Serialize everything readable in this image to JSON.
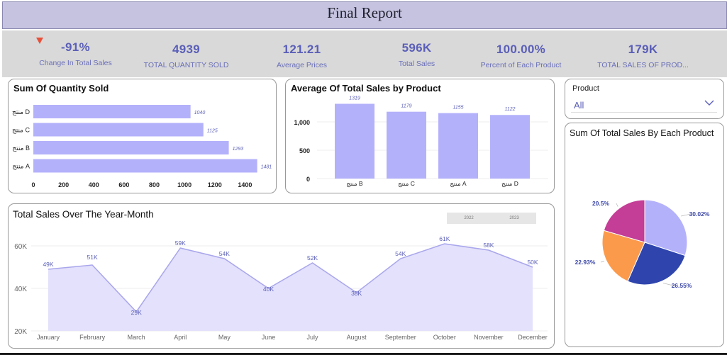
{
  "header": {
    "title": "Final Report"
  },
  "kpis": [
    {
      "value": "-91%",
      "label": "Change In Total Sales",
      "indicator": "down-arrow",
      "indicator_color": "#e8503a"
    },
    {
      "value": "4939",
      "label": "TOTAL QUANTITY SOLD"
    },
    {
      "value": "121.21",
      "label": "Average Prices"
    },
    {
      "value": "596K",
      "label": "Total Sales"
    },
    {
      "value": "100.00%",
      "label": "Percent of Each Product"
    },
    {
      "value": "179K",
      "label": "TOTAL SALES OF PROD..."
    }
  ],
  "colors": {
    "bar": "#b4b1fb",
    "area_fill": "#e3e1fb",
    "area_line": "#a9a6ec",
    "kpi_text": "#5b5fb8",
    "header_bg": "#c5c3e0"
  },
  "slicer": {
    "label": "Product",
    "value": "All"
  },
  "year_tabs": [
    "2022",
    "2023"
  ],
  "chart_data": [
    {
      "type": "bar",
      "orientation": "horizontal",
      "title": "Sum Of Quantity Sold",
      "categories": [
        "منتج D",
        "منتج C",
        "منتج B",
        "منتج A"
      ],
      "values": [
        1040,
        1125,
        1293,
        1481
      ],
      "data_labels": [
        "1040",
        "1125",
        "1293",
        "1481"
      ],
      "xlim": [
        0,
        1600
      ],
      "xticks": [
        "0",
        "200",
        "400",
        "600",
        "800",
        "1000",
        "1200",
        "1400"
      ]
    },
    {
      "type": "bar",
      "title": "Average Of Total Sales by Product",
      "categories": [
        "منتج B",
        "منتج C",
        "منتج A",
        "منتج D"
      ],
      "values": [
        1319,
        1179,
        1155,
        1122
      ],
      "data_labels": [
        "1319",
        "1179",
        "1155",
        "1122"
      ],
      "ylim": [
        0,
        1400
      ],
      "yticks": [
        "0",
        "500",
        "1,000"
      ]
    },
    {
      "type": "area",
      "title": "Total Sales Over The Year-Month",
      "categories": [
        "January",
        "February",
        "March",
        "April",
        "May",
        "June",
        "July",
        "August",
        "September",
        "October",
        "November",
        "December"
      ],
      "values": [
        49,
        51,
        29,
        59,
        54,
        40,
        52,
        38,
        54,
        61,
        58,
        50
      ],
      "data_labels": [
        "49K",
        "51K",
        "29K",
        "59K",
        "54K",
        "40K",
        "52K",
        "38K",
        "54K",
        "61K",
        "58K",
        "50K"
      ],
      "ylim": [
        20,
        65
      ],
      "yticks": [
        "20K",
        "40K",
        "60K"
      ],
      "grid": true
    },
    {
      "type": "pie",
      "title": "Sum Of Total Sales By Each Product",
      "slices": [
        {
          "value": 30.02,
          "label": "30.02%",
          "color": "#b4b1fb"
        },
        {
          "value": 26.55,
          "label": "26.55%",
          "color": "#2f45ad"
        },
        {
          "value": 22.93,
          "label": "22.93%",
          "color": "#fc9a4c"
        },
        {
          "value": 20.5,
          "label": "20.5%",
          "color": "#c43d96"
        }
      ]
    }
  ]
}
